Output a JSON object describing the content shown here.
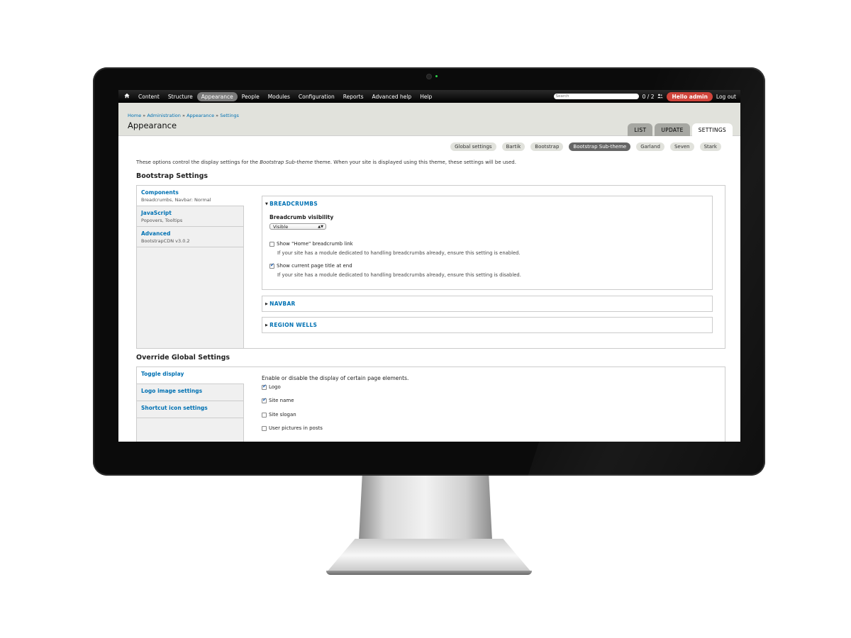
{
  "toolbar": {
    "items": [
      "Content",
      "Structure",
      "Appearance",
      "People",
      "Modules",
      "Configuration",
      "Reports",
      "Advanced help",
      "Help"
    ],
    "active_item": "Appearance",
    "search_placeholder": "Search",
    "count": "0 / 2",
    "hello": "Hello admin",
    "logout": "Log out"
  },
  "header": {
    "breadcrumb": [
      "Home",
      "Administration",
      "Appearance",
      "Settings"
    ],
    "breadcrumb_sep": "»",
    "title": "Appearance",
    "tabs": [
      "LIST",
      "UPDATE",
      "SETTINGS"
    ],
    "active_tab": "SETTINGS"
  },
  "themes": {
    "items": [
      "Global settings",
      "Bartik",
      "Bootstrap",
      "Bootstrap Sub-theme",
      "Garland",
      "Seven",
      "Stark"
    ],
    "active": "Bootstrap Sub-theme"
  },
  "intro": {
    "before": "These options control the display settings for the ",
    "theme_name": "Bootstrap Sub-theme",
    "after": " theme. When your site is displayed using this theme, these settings will be used."
  },
  "bootstrap_settings": {
    "title": "Bootstrap Settings",
    "vertical_tabs": [
      {
        "label": "Components",
        "summary": "Breadcrumbs, Navbar: Normal"
      },
      {
        "label": "JavaScript",
        "summary": "Popovers, Tooltips"
      },
      {
        "label": "Advanced",
        "summary": "BootstrapCDN v3.0.2"
      }
    ],
    "breadcrumbs": {
      "legend": "BREADCRUMBS",
      "visibility_label": "Breadcrumb visibility",
      "visibility_value": "Visible",
      "show_home_label": "Show \"Home\" breadcrumb link",
      "show_home_checked": false,
      "show_home_desc": "If your site has a module dedicated to handling breadcrumbs already, ensure this setting is enabled.",
      "show_title_label": "Show current page title at end",
      "show_title_checked": true,
      "show_title_desc": "If your site has a module dedicated to handling breadcrumbs already, ensure this setting is disabled."
    },
    "navbar_legend": "NAVBAR",
    "region_wells_legend": "REGION WELLS"
  },
  "override_global": {
    "title": "Override Global Settings",
    "vertical_tabs": [
      "Toggle display",
      "Logo image settings",
      "Shortcut icon settings"
    ],
    "toggle_text": "Enable or disable the display of certain page elements.",
    "toggles": [
      {
        "label": "Logo",
        "checked": true
      },
      {
        "label": "Site name",
        "checked": true
      },
      {
        "label": "Site slogan",
        "checked": false
      },
      {
        "label": "User pictures in posts",
        "checked": false
      }
    ]
  },
  "colors": {
    "link": "#0071b3",
    "hello_badge": "#d0443b",
    "header_bg": "#e1e2dc"
  }
}
